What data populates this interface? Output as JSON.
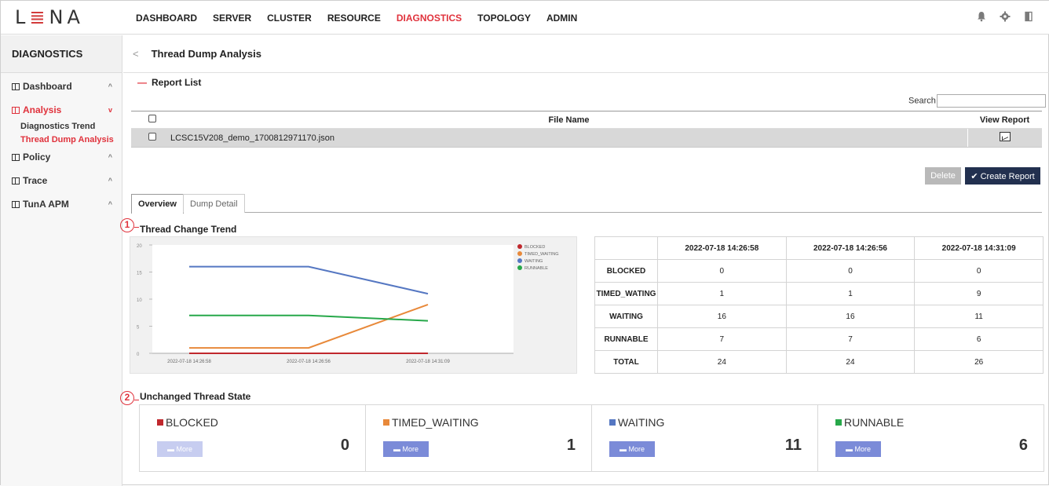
{
  "logo": {
    "pre": "L",
    "bars": "≣",
    "post": "NA"
  },
  "menu": [
    "DASHBOARD",
    "SERVER",
    "CLUSTER",
    "RESOURCE",
    "DIAGNOSTICS",
    "TOPOLOGY",
    "ADMIN"
  ],
  "menu_active": "DIAGNOSTICS",
  "top_icons": [
    "bell-icon",
    "gear-icon",
    "door-icon"
  ],
  "sidebar": {
    "title": "DIAGNOSTICS",
    "items": [
      {
        "label": "Dashboard",
        "chevron": "^"
      },
      {
        "label": "Analysis",
        "chevron": "v"
      },
      {
        "label": "Policy",
        "chevron": "^"
      },
      {
        "label": "Trace",
        "chevron": "^"
      },
      {
        "label": "TunA APM",
        "chevron": "^"
      }
    ],
    "sub": [
      "Diagnostics Trend",
      "Thread Dump Analysis"
    ]
  },
  "breadcrumb": {
    "back": "<",
    "title": "Thread Dump Analysis"
  },
  "report_list": {
    "title": "Report List",
    "search_label": "Search",
    "headers": {
      "file_name": "File Name",
      "view_report": "View Report"
    },
    "rows": [
      {
        "file_name": "LCSC15V208_demo_1700812971170.json"
      }
    ],
    "delete_label": "Delete",
    "create_label": "✔ Create Report"
  },
  "tabs": [
    "Overview",
    "Dump Detail"
  ],
  "section1": {
    "num": "1",
    "title": "Thread Change Trend"
  },
  "section2": {
    "num": "2",
    "title": "Unchanged Thread State"
  },
  "chart_data": {
    "type": "line",
    "categories": [
      "2022-07-18 14:26:58",
      "2022-07-18 14:26:56",
      "2022-07-18 14:31:09"
    ],
    "series": [
      {
        "name": "BLOCKED",
        "color": "#c0282d",
        "values": [
          0,
          0,
          0
        ]
      },
      {
        "name": "TIMED_WAITING",
        "color": "#e8893a",
        "values": [
          1,
          1,
          9
        ]
      },
      {
        "name": "WAITING",
        "color": "#5577c2",
        "values": [
          16,
          16,
          11
        ]
      },
      {
        "name": "RUNNABLE",
        "color": "#27a84a",
        "values": [
          7,
          7,
          6
        ]
      }
    ],
    "ylim": [
      0,
      20
    ],
    "yticks": [
      "0",
      "5",
      "10",
      "15",
      "20"
    ],
    "legend": "top-right"
  },
  "table": {
    "headers": [
      "2022-07-18 14:26:58",
      "2022-07-18 14:26:56",
      "2022-07-18 14:31:09"
    ],
    "rows": [
      {
        "label": "BLOCKED",
        "values": [
          "0",
          "0",
          "0"
        ]
      },
      {
        "label": "TIMED_WATING",
        "values": [
          "1",
          "1",
          "9"
        ]
      },
      {
        "label": "WAITING",
        "values": [
          "16",
          "16",
          "11"
        ]
      },
      {
        "label": "RUNNABLE",
        "values": [
          "7",
          "7",
          "6"
        ]
      },
      {
        "label": "TOTAL",
        "values": [
          "24",
          "24",
          "26"
        ]
      }
    ]
  },
  "cards": [
    {
      "label": "BLOCKED",
      "value": "0",
      "color": "#c0282d",
      "more": "More",
      "dim": true
    },
    {
      "label": "TIMED_WAITING",
      "value": "1",
      "color": "#e8893a",
      "more": "More",
      "dim": false
    },
    {
      "label": "WAITING",
      "value": "11",
      "color": "#5577c2",
      "more": "More",
      "dim": false
    },
    {
      "label": "RUNNABLE",
      "value": "6",
      "color": "#27a84a",
      "more": "More",
      "dim": false
    }
  ]
}
